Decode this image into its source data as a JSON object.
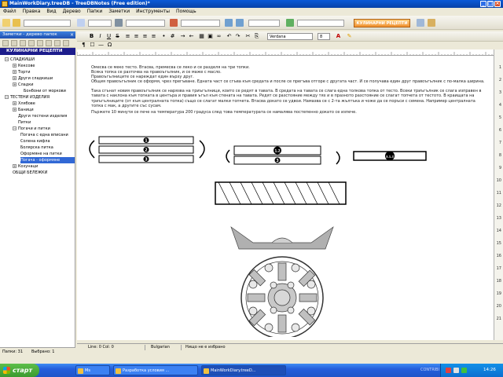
{
  "window": {
    "title": "MainWorkDiary.treeDB - TreeDBNotes (Free edition)*",
    "minimize": "_",
    "maximize": "□",
    "close": "×"
  },
  "menu": [
    "Файл",
    "Правка",
    "Вид",
    "Дерево",
    "Папки",
    "Заметки",
    "Инструменты",
    "Помощь"
  ],
  "section_badge": "КУЛИНАРНИ РЕЦЕПТИ",
  "left_panel": {
    "header": "Заметки - дерево папок",
    "close": "×",
    "root": "КУЛИНАРНИ РЕЦЕПТИ",
    "tree": [
      {
        "label": "СЛАДКИШИ",
        "level": 1,
        "toggle": "−"
      },
      {
        "label": "Кексове",
        "level": 2,
        "toggle": "+"
      },
      {
        "label": "Торти",
        "level": 2,
        "toggle": "+"
      },
      {
        "label": "Други сладкиши",
        "level": 2,
        "toggle": "+"
      },
      {
        "label": "Сладки",
        "level": 2,
        "toggle": "+"
      },
      {
        "label": "Бонбони от моркови",
        "level": 3,
        "toggle": ""
      },
      {
        "label": "ТЕСТЕНИ ИЗДЕЛИЯ",
        "level": 1,
        "toggle": "−"
      },
      {
        "label": "Хлябове",
        "level": 2,
        "toggle": "+"
      },
      {
        "label": "Баници",
        "level": 2,
        "toggle": "+"
      },
      {
        "label": "Други тестени изделия",
        "level": 2,
        "toggle": ""
      },
      {
        "label": "Питки",
        "level": 2,
        "toggle": ""
      },
      {
        "label": "Погачи и питки",
        "level": 2,
        "toggle": "−"
      },
      {
        "label": "Погача с една вписани",
        "level": 3,
        "toggle": ""
      },
      {
        "label": "Солена кифла",
        "level": 3,
        "toggle": ""
      },
      {
        "label": "Болярска питка",
        "level": 3,
        "toggle": ""
      },
      {
        "label": "Оформяне на питки",
        "level": 3,
        "toggle": ""
      },
      {
        "label": "Погача - оформяне",
        "level": 3,
        "toggle": "",
        "selected": true
      },
      {
        "label": "Козунаци",
        "level": 2,
        "toggle": "+"
      },
      {
        "label": "ОБЩИ БЕЛЕЖКИ",
        "level": 1,
        "toggle": ""
      }
    ],
    "status": {
      "folders": "Папки: 31",
      "selected": "Выбрано: 1"
    }
  },
  "format_toolbar": {
    "bold": "B",
    "italic": "I",
    "underline": "U",
    "strike": "S",
    "font": "Verdana",
    "size": "8"
  },
  "document": {
    "paragraphs": [
      "Омесва се меко тесто. Втасва, премесва се леко и се разделя на три топки.",
      "Всяка топка се разточва на правоъгълник, и се маже с масло.",
      "Правоъгълниците се нареждат един върху друг.",
      "Общия правоъгълник се оформя, чрез прегъване. Едната част се сгъва към средата и после се прегъва отгоре с другата част. И се получава един друг правоъгълник с по-малка ширина.",
      "Така сгънат новия правоъгълник се нарязва на триъгълници, които се редят в тавата. В средата на тавата се слага една толкова топка от тесто. Всеки триъгълник се слага изправен в тавата с наклона към топката в центъра и правия ъгъл към стената на тавата. Редят се разстояние между тях и в празното разстояние се слагат топчета от тестото. В краищата на триъгълниците (от към централната топка) също се слагат малки топчета. Втасва докато се удвои. Намазва се с 2-та жълтъка и чоже да се поръси с семена. Например централната топка с мак, а другите със сусам.",
      "Пържете 10 минути се пече на температура 200 градуса след това температурата се намалява постепенно докато се изпече."
    ],
    "diagram_labels": {
      "n1": "1",
      "n2": "2",
      "n3": "3",
      "n12": "1,2",
      "n312": "3,1,2"
    }
  },
  "status_bar": {
    "position": "Line: 0 Col: 0",
    "language": "Bulgarian",
    "selection": "Нищо не е избрано"
  },
  "ruler_numbers": [
    "1",
    "2",
    "3",
    "4",
    "5",
    "6",
    "7",
    "8",
    "9",
    "10",
    "11",
    "12",
    "13",
    "14",
    "15",
    "16",
    "17",
    "18",
    "19",
    "20",
    "21",
    "22",
    "23",
    "24"
  ],
  "taskbar": {
    "start": "старт",
    "tasks": [
      "Ms",
      "Разработка условия ...",
      "MainWorkDiary.treeD..."
    ],
    "tray_time": "14:26",
    "watermark": "CONTRIBI"
  }
}
